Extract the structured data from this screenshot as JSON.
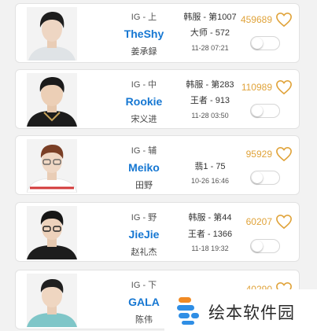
{
  "colors": {
    "accent": "#1677d2",
    "likes": "#e0a33a",
    "heart": "#e0a33a"
  },
  "players": [
    {
      "team_pos": "IG - 上",
      "name": "TheShy",
      "cname": "姜承録",
      "server": "韩服 - 第1007",
      "rank": "大师 - 572",
      "time": "11-28 07:21",
      "likes": "459689"
    },
    {
      "team_pos": "IG - 中",
      "name": "Rookie",
      "cname": "宋义进",
      "server": "韩服 - 第283",
      "rank": "王者 - 913",
      "time": "11-28 03:50",
      "likes": "110989"
    },
    {
      "team_pos": "IG - 辅",
      "name": "Meiko",
      "cname": "田野",
      "server": "",
      "rank": "翡1 - 75",
      "time": "10-26 16:46",
      "likes": "95929"
    },
    {
      "team_pos": "IG - 野",
      "name": "JieJie",
      "cname": "赵礼杰",
      "server": "韩服 - 第44",
      "rank": "王者 - 1366",
      "time": "11-18 19:32",
      "likes": "60207"
    },
    {
      "team_pos": "IG - 下",
      "name": "GALA",
      "cname": "陈伟",
      "server": "",
      "rank": "",
      "time": "",
      "likes": "40290"
    }
  ],
  "watermark": {
    "text": "绘本软件园",
    "icon": "watermark-logo-icon"
  }
}
